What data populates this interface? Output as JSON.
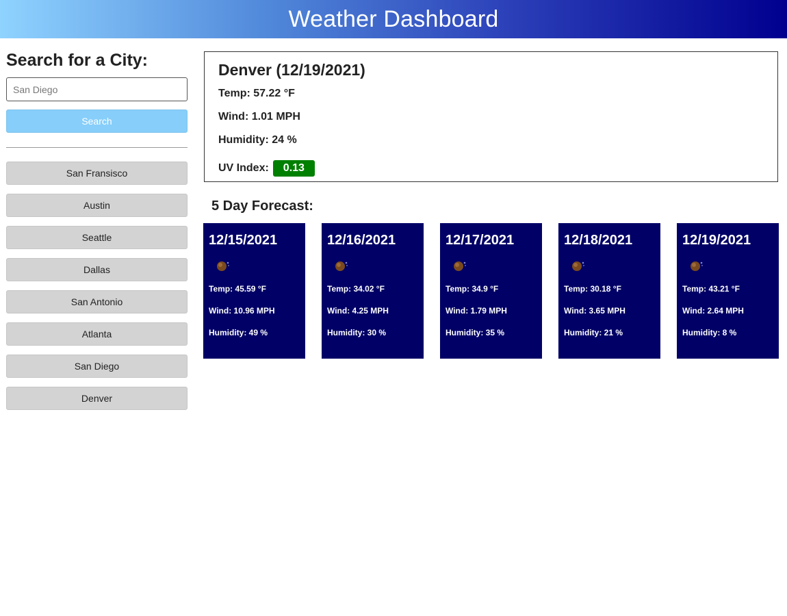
{
  "header": {
    "title": "Weather Dashboard"
  },
  "search": {
    "heading": "Search for a City:",
    "placeholder": "San Diego",
    "button_label": "Search"
  },
  "history": [
    "San Fransisco",
    "Austin",
    "Seattle",
    "Dallas",
    "San Antonio",
    "Atlanta",
    "San Diego",
    "Denver"
  ],
  "current": {
    "title": "Denver (12/19/2021)",
    "temp": "Temp: 57.22 °F",
    "wind": "Wind: 1.01 MPH",
    "humidity": "Humidity: 24 %",
    "uv_label": "UV Index:",
    "uv_value": "0.13",
    "uv_color": "#008000"
  },
  "forecast": {
    "heading": "5 Day Forecast:",
    "days": [
      {
        "date": "12/15/2021",
        "icon": "moon-icon",
        "temp": "Temp: 45.59 °F",
        "wind": "Wind: 10.96 MPH",
        "humidity": "Humidity: 49 %"
      },
      {
        "date": "12/16/2021",
        "icon": "moon-icon",
        "temp": "Temp: 34.02 °F",
        "wind": "Wind: 4.25 MPH",
        "humidity": "Humidity: 30 %"
      },
      {
        "date": "12/17/2021",
        "icon": "moon-icon",
        "temp": "Temp: 34.9 °F",
        "wind": "Wind: 1.79 MPH",
        "humidity": "Humidity: 35 %"
      },
      {
        "date": "12/18/2021",
        "icon": "moon-icon",
        "temp": "Temp: 30.18 °F",
        "wind": "Wind: 3.65 MPH",
        "humidity": "Humidity: 21 %"
      },
      {
        "date": "12/19/2021",
        "icon": "moon-icon",
        "temp": "Temp: 43.21 °F",
        "wind": "Wind: 2.64 MPH",
        "humidity": "Humidity: 8 %"
      }
    ]
  },
  "colors": {
    "card_bg": "#000066",
    "search_button": "#87cefa",
    "history_button": "#d3d3d3"
  }
}
